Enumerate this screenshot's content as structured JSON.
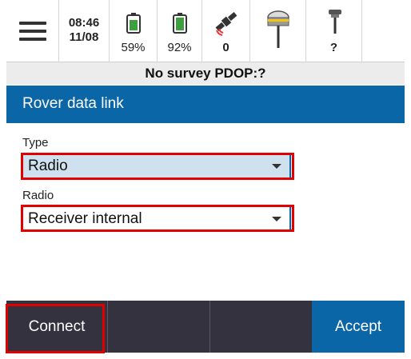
{
  "status": {
    "time": "08:46",
    "date": "11/08",
    "battery_1": "59%",
    "battery_2": "92%",
    "satellites": "0",
    "receiver_status": "?",
    "survey_status": "No survey  PDOP:?"
  },
  "header": {
    "title": "Rover data link"
  },
  "form": {
    "type_label": "Type",
    "type_value": "Radio",
    "radio_label": "Radio",
    "radio_value": "Receiver internal"
  },
  "buttons": {
    "connect": "Connect",
    "accept": "Accept"
  },
  "colors": {
    "accent": "#0b66a8",
    "bottom_bar": "#34323f",
    "selected_field": "#cfe0ef",
    "highlight": "#e00000",
    "battery": "#3f9e3f"
  },
  "icons": [
    "menu-icon",
    "battery-icon",
    "satellite-icon",
    "gnss-receiver-icon",
    "receiver-pole-icon",
    "dropdown-arrow-icon"
  ]
}
